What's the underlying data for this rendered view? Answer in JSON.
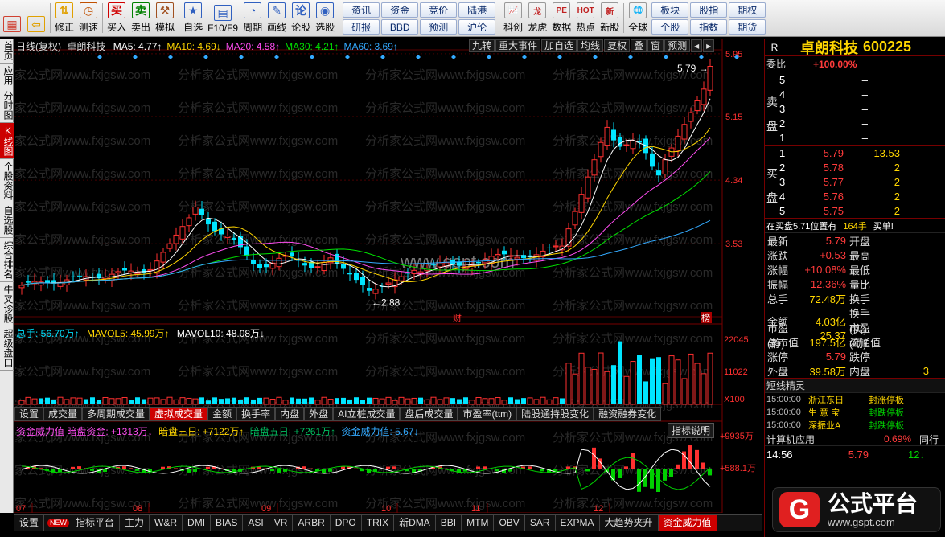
{
  "toolbar": {
    "buttons": [
      {
        "label": "",
        "icon": "grid-icon",
        "color": "#d04030"
      },
      {
        "label": "",
        "icon": "back-arrow-icon",
        "color": "#e0a000"
      },
      {
        "label": "修正",
        "icon": "up-down-arrow-icon",
        "color": "#e0a000"
      },
      {
        "label": "测速",
        "icon": "clock-icon",
        "color": "#c05000"
      },
      {
        "label": "买入",
        "icon": "buy-icon",
        "color": "#d00000"
      },
      {
        "label": "卖出",
        "icon": "sell-icon",
        "color": "#008000"
      },
      {
        "label": "模拟",
        "icon": "hammer-icon",
        "color": "#a05020"
      },
      {
        "label": "自选",
        "icon": "star-folder-icon",
        "color": "#3060c0"
      },
      {
        "label": "F10/F9",
        "icon": "f10-icon",
        "color": "#3060c0"
      },
      {
        "label": "周期",
        "icon": "period-icon",
        "color": "#3060c0"
      },
      {
        "label": "画线",
        "icon": "pencil-icon",
        "color": "#3060c0"
      },
      {
        "label": "论股",
        "icon": "discuss-icon",
        "color": "#3060c0"
      },
      {
        "label": "选股",
        "icon": "select-stock-icon",
        "color": "#3060c0"
      }
    ],
    "pairs": [
      [
        "资讯",
        "资金"
      ],
      [
        "研报",
        "BBD"
      ],
      [
        "竞价",
        "陆港"
      ],
      [
        "预测",
        "沪伦"
      ]
    ],
    "buttons2": [
      {
        "label": "科创",
        "icon": "chart-icon"
      },
      {
        "label": "龙虎",
        "icon": "dragon-icon"
      },
      {
        "label": "数据",
        "icon": "pe-icon"
      },
      {
        "label": "热点",
        "icon": "hot-icon"
      },
      {
        "label": "新股",
        "icon": "new-stock-icon"
      },
      {
        "label": "全球",
        "icon": "globe-icon"
      }
    ],
    "pairs2": [
      [
        "板块",
        "股指"
      ],
      [
        "个股",
        "指数"
      ]
    ],
    "pairs3": [
      [
        "期权"
      ],
      [
        "期货"
      ]
    ]
  },
  "lefttabs": [
    "首页",
    "应用",
    "分时图",
    "K线图",
    "个股资料",
    "自选股",
    "综合排名",
    "牛叉诊股",
    "超级盘口"
  ],
  "main": {
    "title": "日线(复权)",
    "stock": "卓朗科技",
    "ma": [
      {
        "label": "MA5: 4.77↑",
        "color": "#ffffff"
      },
      {
        "label": "MA10: 4.69↓",
        "color": "#ffd600"
      },
      {
        "label": "MA20: 4.58↑",
        "color": "#ff4df2"
      },
      {
        "label": "MA30: 4.21↑",
        "color": "#00e000"
      },
      {
        "label": "MA60: 3.69↑",
        "color": "#33aaff"
      }
    ],
    "buttons": [
      "九转",
      "重大事件",
      "加自选",
      "均线",
      "复权",
      "叠",
      "窗",
      "预测"
    ],
    "yticks": [
      "5.95",
      "5.15",
      "4.34",
      "3.53"
    ],
    "high_label": "5.79",
    "low_label": "2.88",
    "watermark": "www.gspt.com",
    "wm_text": "分析家公式网www.fxjgsw.com",
    "marker_cai": "财",
    "marker_bang": "榜"
  },
  "vol": {
    "total": "总手: 56.70万↑",
    "mavol5": "MAVOL5: 45.99万↑",
    "mavol10": "MAVOL10: 48.08万↓",
    "yticks": [
      "22045",
      "11022",
      "X100"
    ]
  },
  "tabs": [
    "设置",
    "成交量",
    "多周期成交量",
    "虚拟成交量",
    "金额",
    "换手率",
    "内盘",
    "外盘",
    "AI立桩成交量",
    "盘后成交量",
    "市盈率(ttm)",
    "陆股通持股变化",
    "融资融券变化"
  ],
  "active_tab": 3,
  "ind": {
    "l1": "资金威力值 暗盘资金: +1313万↓",
    "l2": "暗盘三日: +7122万↑",
    "l3": "暗盘五日: +7261万↑",
    "l4": "资金威力值: 5.67↓",
    "btn": "指标说明",
    "yticks": [
      "+9935万",
      "+588.1万"
    ]
  },
  "months": [
    "07",
    "08",
    "09",
    "10",
    "11",
    "12"
  ],
  "bottom": [
    "设置",
    "NEW",
    "指标平台",
    "主力",
    "W&R",
    "DMI",
    "BIAS",
    "ASI",
    "VR",
    "ARBR",
    "DPO",
    "TRIX",
    "新DMA",
    "BBI",
    "MTM",
    "OBV",
    "SAR",
    "EXPMA",
    "大趋势夹升",
    "资金威力值"
  ],
  "right": {
    "r": "R",
    "name": "卓朗科技",
    "code": "600225",
    "weibi_label": "委比",
    "weibi": "+100.00%",
    "sell_label": "卖盘",
    "buy_label": "买盘",
    "sell": [
      [
        "5",
        "–"
      ],
      [
        "4",
        "–"
      ],
      [
        "3",
        "–"
      ],
      [
        "2",
        "–"
      ],
      [
        "1",
        "–"
      ]
    ],
    "buy": [
      [
        "1",
        "5.79",
        "13.53"
      ],
      [
        "2",
        "5.78",
        "2"
      ],
      [
        "3",
        "5.77",
        "2"
      ],
      [
        "4",
        "5.76",
        "2"
      ],
      [
        "5",
        "5.75",
        "2"
      ]
    ],
    "zaimaipan": "在买盘5.71位置有",
    "zaimaipan_v": "164手",
    "zaimaipan_r": "买单!",
    "stats": [
      [
        "最新",
        "5.79",
        "开盘",
        ""
      ],
      [
        "涨跌",
        "+0.53",
        "最高",
        ""
      ],
      [
        "涨幅",
        "+10.08%",
        "最低",
        ""
      ],
      [
        "振幅",
        "12.36%",
        "量比",
        ""
      ],
      [
        "总手",
        "72.48万",
        "换手",
        ""
      ],
      [
        "金额",
        "4.03亿",
        "换手(实)",
        ""
      ],
      [
        "市盈(静)",
        "25.37",
        "市盈(动)",
        ""
      ],
      [
        "总市值",
        "197.5亿",
        "流通值",
        ""
      ],
      [
        "涨停",
        "5.79",
        "跌停",
        ""
      ],
      [
        "外盘",
        "39.58万",
        "内盘",
        "3"
      ]
    ],
    "jingxuan": "短线精灵",
    "news": [
      [
        "15:00:00",
        "浙江东日",
        "封涨停板"
      ],
      [
        "15:00:00",
        "生 意 宝",
        "封跌停板"
      ],
      [
        "15:00:00",
        "深振业A",
        "封跌停板"
      ]
    ],
    "calc": "计算机应用",
    "calc_pct": "0.69%",
    "tonghang": "同行",
    "ticks": [
      [
        "14:56",
        "5.79",
        "12↓"
      ]
    ],
    "logo_text": "公式平台",
    "logo_url": "www.gspt.com"
  },
  "chart_data": {
    "type": "candlestick",
    "price_range": [
      2.6,
      6.0
    ],
    "vol_max": 22045
  },
  "colors": {
    "up": "#ff3030",
    "down": "#00e5ff",
    "active": "#cc0000"
  }
}
